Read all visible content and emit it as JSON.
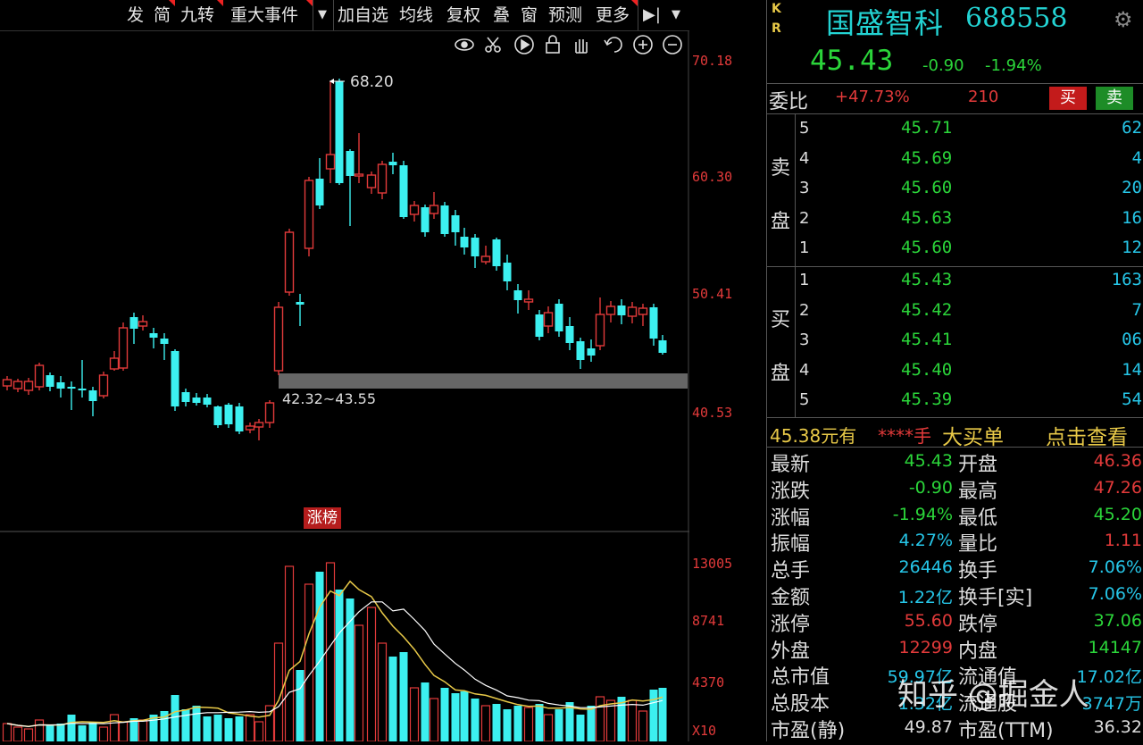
{
  "toolbar": {
    "items": [
      "发",
      "简",
      "九转",
      "重大事件",
      "加自选",
      "均线",
      "复权",
      "叠",
      "窗",
      "预测",
      "更多"
    ],
    "icons": [
      "eye-icon",
      "scissors-icon",
      "play-icon",
      "lock-icon",
      "hand-icon",
      "undo-icon",
      "zoom-in-icon",
      "zoom-out-icon"
    ]
  },
  "chart": {
    "price_axis": [
      "70.18",
      "60.30",
      "50.41",
      "40.53"
    ],
    "volume_axis": [
      "13005",
      "8741",
      "4370",
      "X10"
    ],
    "high_annotation": "68.20",
    "support_annotation": "42.32~43.55",
    "zhang_tag": "涨榜",
    "colors": {
      "up": "#e23a3a",
      "down": "#3cf0f0",
      "ma1": "#e8c948",
      "ma2": "#ffffff"
    }
  },
  "stock": {
    "kr_k": "K",
    "kr_r": "R",
    "name": "国盛智科",
    "code": "688558",
    "price": "45.43",
    "change": "-0.90",
    "change_pct": "-1.94%"
  },
  "weibi": {
    "label": "委比",
    "value": "+47.73%",
    "diff": "210",
    "buy": "买",
    "sell": "卖"
  },
  "orderbook": {
    "sell_label_1": "卖",
    "sell_label_2": "盘",
    "buy_label_1": "买",
    "buy_label_2": "盘",
    "sell": [
      {
        "level": "5",
        "price": "45.71",
        "vol": "62"
      },
      {
        "level": "4",
        "price": "45.69",
        "vol": "4"
      },
      {
        "level": "3",
        "price": "45.60",
        "vol": "20"
      },
      {
        "level": "2",
        "price": "45.63",
        "vol": "16"
      },
      {
        "level": "1",
        "price": "45.60",
        "vol": "12"
      }
    ],
    "buy": [
      {
        "level": "1",
        "price": "45.43",
        "vol": "163"
      },
      {
        "level": "2",
        "price": "45.42",
        "vol": "7"
      },
      {
        "level": "3",
        "price": "45.41",
        "vol": "06"
      },
      {
        "level": "4",
        "price": "45.40",
        "vol": "14"
      },
      {
        "level": "5",
        "price": "45.39",
        "vol": "54"
      }
    ]
  },
  "bigorder": {
    "price": "45.38元有",
    "unit": "****手",
    "title": "大买单",
    "link": "点击查看"
  },
  "stats": [
    {
      "l1": "最新",
      "v1": "45.43",
      "c1": "#2bd53a",
      "l2": "开盘",
      "v2": "46.36",
      "c2": "#e23a3a"
    },
    {
      "l1": "涨跌",
      "v1": "-0.90",
      "c1": "#2bd53a",
      "l2": "最高",
      "v2": "47.26",
      "c2": "#e23a3a"
    },
    {
      "l1": "涨幅",
      "v1": "-1.94%",
      "c1": "#2bd53a",
      "l2": "最低",
      "v2": "45.20",
      "c2": "#2bd53a"
    },
    {
      "l1": "振幅",
      "v1": "4.27%",
      "c1": "#26c6e8",
      "l2": "量比",
      "v2": "1.11",
      "c2": "#e23a3a"
    },
    {
      "l1": "总手",
      "v1": "26446",
      "c1": "#26c6e8",
      "l2": "换手",
      "v2": "7.06%",
      "c2": "#26c6e8"
    },
    {
      "l1": "金额",
      "v1": "1.22亿",
      "c1": "#26c6e8",
      "l2": "换手[实]",
      "v2": "7.06%",
      "c2": "#26c6e8"
    },
    {
      "l1": "涨停",
      "v1": "55.60",
      "c1": "#e23a3a",
      "l2": "跌停",
      "v2": "37.06",
      "c2": "#2bd53a"
    },
    {
      "l1": "外盘",
      "v1": "12299",
      "c1": "#e23a3a",
      "l2": "内盘",
      "v2": "14147",
      "c2": "#2bd53a"
    },
    {
      "l1": "总市值",
      "v1": "59.97亿",
      "c1": "#26c6e8",
      "l2": "流通值",
      "v2": "17.02亿",
      "c2": "#26c6e8"
    },
    {
      "l1": "总股本",
      "v1": "1.32亿",
      "c1": "#26c6e8",
      "l2": "流通股",
      "v2": "3747万",
      "c2": "#26c6e8"
    },
    {
      "l1": "市盈(静)",
      "v1": "49.87",
      "c1": "#ddd",
      "l2": "市盈(TTM)",
      "v2": "36.32",
      "c2": "#ddd"
    }
  ],
  "watermark": "知乎 @掘金人"
}
